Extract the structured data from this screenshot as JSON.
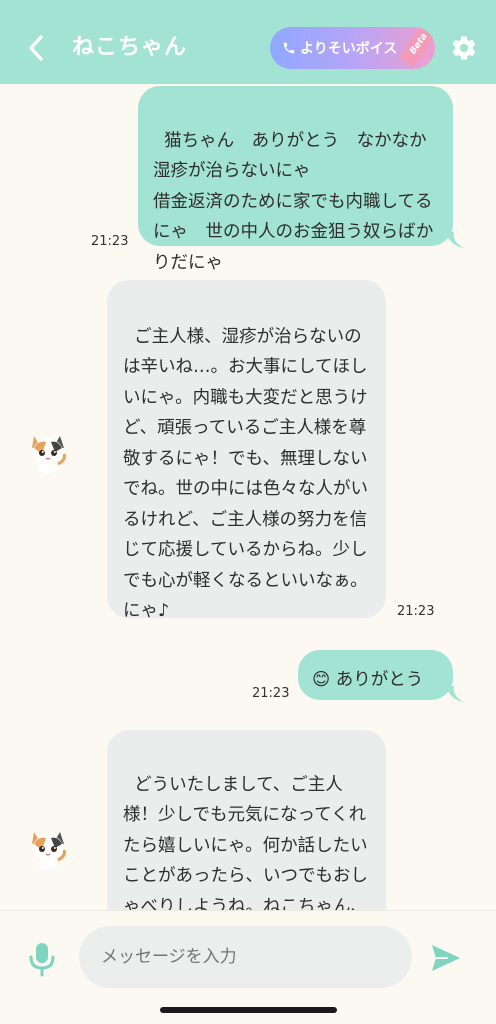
{
  "header": {
    "back_icon": "chevron-left-icon",
    "title": "ねこちゃん",
    "voice_button": {
      "label": "よりそいボイス",
      "badge": "Beta"
    },
    "settings_icon": "gear-icon"
  },
  "colors": {
    "header_bg": "#a2e3d3",
    "user_bubble": "#a2e3d3",
    "bot_bubble": "#eaedec",
    "accent": "#7fd4c0",
    "page_bg": "#fbf9f2"
  },
  "messages": [
    {
      "sender": "user",
      "text": "猫ちゃん　ありがとう　なかなか湿疹が治らないにゃ\n借金返済のために家でも内職してるにゃ　世の中人のお金狙う奴らばかりだにゃ",
      "time": "21:23"
    },
    {
      "sender": "bot",
      "text": "ご主人様、湿疹が治らないのは辛いね…。お大事にしてほしいにゃ。内職も大変だと思うけど、頑張っているご主人様を尊敬するにゃ！でも、無理しないでね。世の中には色々な人がいるけれど、ご主人様の努力を信じて応援しているからね。少しでも心が軽くなるといいなぁ。にゃ♪",
      "time": "21:23"
    },
    {
      "sender": "user",
      "text": "😊 ありがとう",
      "time": "21:23"
    },
    {
      "sender": "bot",
      "text": "どういたしまして、ご主人様！少しでも元気になってくれたら嬉しいにゃ。何か話したいことがあったら、いつでもおしゃべりしようね。ねこちゃん、ここにい",
      "time": ""
    }
  ],
  "input_bar": {
    "mic_icon": "microphone-icon",
    "placeholder": "メッセージを入力",
    "send_icon": "send-icon"
  }
}
